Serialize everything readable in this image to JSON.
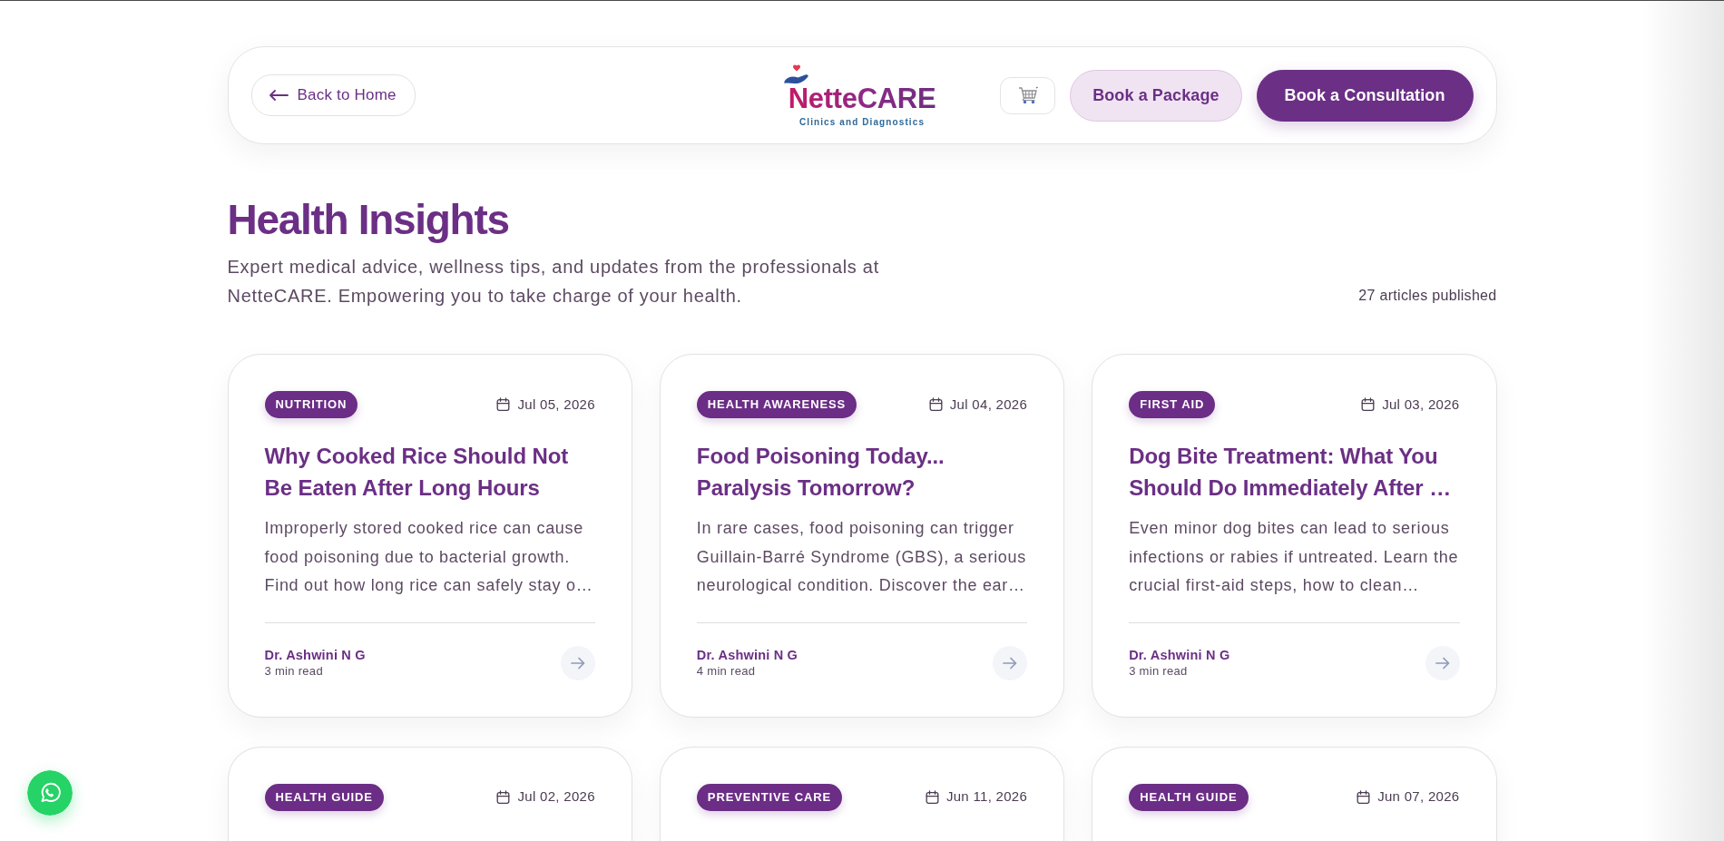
{
  "header": {
    "back_button": "Back to Home",
    "logo": {
      "name": "NetteCARE",
      "tagline": "Clinics and Diagnostics"
    },
    "buttons": [
      {
        "label": "Book a Package",
        "kind": "outline"
      },
      {
        "label": "Book a Consultation",
        "kind": "filled"
      }
    ]
  },
  "intro": {
    "title": "Health Insights",
    "description": "Expert medical advice, wellness tips, and updates from the professionals at NetteCARE. Empowering you to take charge of your health.",
    "count": "27 articles published"
  },
  "articles": [
    {
      "category": "NUTRITION",
      "date": "Jul 05, 2026",
      "title": "Why Cooked Rice Should Not Be Eaten After Long Hours",
      "excerpt": "Improperly stored cooked rice can cause food poisoning due to bacterial growth. Find out how long rice can safely stay o…",
      "author": "Dr. Ashwini N G",
      "read_time": "3 min read"
    },
    {
      "category": "HEALTH AWARENESS",
      "date": "Jul 04, 2026",
      "title": "Food Poisoning Today... Paralysis Tomorrow?",
      "excerpt": "In rare cases, food poisoning can trigger Guillain-Barré Syndrome (GBS), a serious neurological condition. Discover the ear…",
      "author": "Dr. Ashwini N G",
      "read_time": "4 min read"
    },
    {
      "category": "FIRST AID",
      "date": "Jul 03, 2026",
      "title": "Dog Bite Treatment: What You Should Do Immediately After …",
      "excerpt": "Even minor dog bites can lead to serious infections or rabies if untreated. Learn the crucial first-aid steps, how to clean…",
      "author": "Dr. Ashwini N G",
      "read_time": "3 min read"
    },
    {
      "category": "HEALTH GUIDE",
      "date": "Jul 02, 2026"
    },
    {
      "category": "PREVENTIVE CARE",
      "date": "Jun 11, 2026"
    },
    {
      "category": "HEALTH GUIDE",
      "date": "Jun 07, 2026"
    }
  ]
}
